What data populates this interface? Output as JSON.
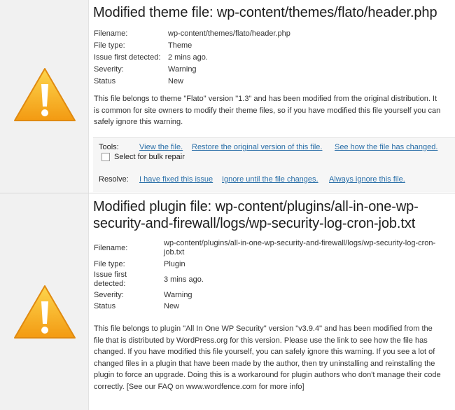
{
  "issues": [
    {
      "title": "Modified theme file: wp-content/themes/flato/header.php",
      "fields": [
        {
          "label": "Filename:",
          "value": "wp-content/themes/flato/header.php"
        },
        {
          "label": "File type:",
          "value": "Theme"
        },
        {
          "label": "Issue first detected:",
          "value": "2 mins ago."
        },
        {
          "label": "Severity:",
          "value": "Warning"
        },
        {
          "label": "Status",
          "value": "New"
        }
      ],
      "description": "This file belongs to theme \"Flato\" version \"1.3\" and has been modified from the original distribution. It is common for site owners to modify their theme files, so if you have modified this file yourself you can safely ignore this warning.",
      "tools_label": "Tools:",
      "tool_links": [
        "View the file.",
        "Restore the original version of this file.",
        "See how the file has changed."
      ],
      "bulk_label": "Select for bulk repair",
      "resolve_label": "Resolve:",
      "resolve_links": [
        "I have fixed this issue",
        "Ignore until the file changes.",
        "Always ignore this file."
      ]
    },
    {
      "title": "Modified plugin file: wp-content/plugins/all-in-one-wp-security-and-firewall/logs/wp-security-log-cron-job.txt",
      "fields": [
        {
          "label": "Filename:",
          "value": "wp-content/plugins/all-in-one-wp-security-and-firewall/logs/wp-security-log-cron-job.txt"
        },
        {
          "label": "File type:",
          "value": "Plugin"
        },
        {
          "label": "Issue first detected:",
          "value": "3 mins ago."
        },
        {
          "label": "Severity:",
          "value": "Warning"
        },
        {
          "label": "Status",
          "value": "New"
        }
      ],
      "description": "This file belongs to plugin \"All In One WP Security\" version \"v3.9.4\" and has been modified from the file that is distributed by WordPress.org for this version. Please use the link to see how the file has changed. If you have modified this file yourself, you can safely ignore this warning. If you see a lot of changed files in a plugin that have been made by the author, then try uninstalling and reinstalling the plugin to force an upgrade. Doing this is a workaround for plugin authors who don't manage their code correctly. [See our FAQ on www.wordfence.com for more info]"
    }
  ],
  "icons": {
    "warning": "warning-triangle-icon"
  },
  "colors": {
    "warning_orange": "#f5a623",
    "link_blue": "#2a6fa8",
    "icon_column_bg": "#f1f1f1"
  }
}
